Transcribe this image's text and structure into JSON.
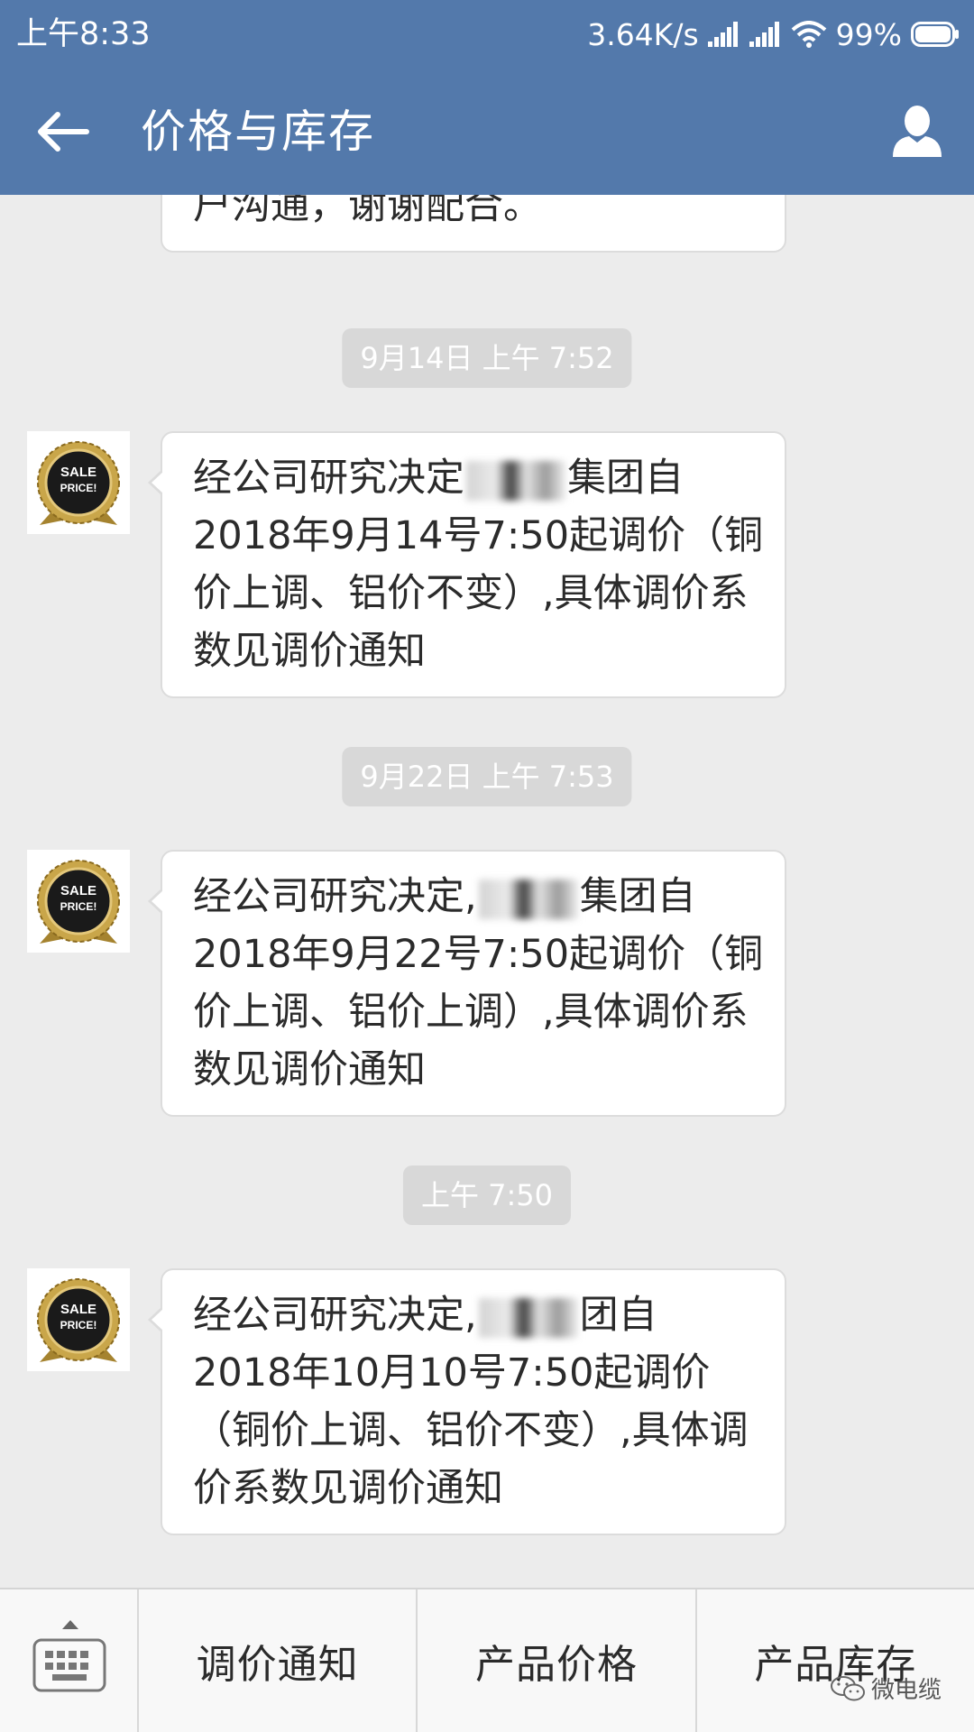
{
  "status_bar": {
    "time": "上午8:33",
    "network_speed": "3.64K/s",
    "battery": "99%",
    "icons": [
      "signal-icon",
      "signal-icon",
      "wifi-icon",
      "battery-icon"
    ]
  },
  "header": {
    "back_icon": "back-arrow-icon",
    "title": "价格与库存",
    "profile_icon": "person-icon"
  },
  "messages": [
    {
      "lines": [
        "户沟通，谢谢配合。"
      ]
    },
    {
      "timestamp": "9月14日  上午 7:52",
      "avatar": "SALE PRICE!",
      "lines": [
        {
          "before": "经公司研究决定",
          "after": "集团自"
        },
        "2018年9月14号7:50起调价（铜",
        "价上调、铝价不变）,具体调价系",
        "数见调价通知"
      ]
    },
    {
      "timestamp": "9月22日  上午 7:53",
      "avatar": "SALE PRICE!",
      "lines": [
        {
          "before": "经公司研究决定,",
          "after": "集团自"
        },
        "2018年9月22号7:50起调价（铜",
        "价上调、铝价上调）,具体调价系",
        "数见调价通知"
      ]
    },
    {
      "timestamp": "上午 7:50",
      "avatar": "SALE PRICE!",
      "lines": [
        {
          "before": "经公司研究决定,",
          "after": "团自"
        },
        "2018年10月10号7:50起调价",
        "（铜价上调、铝价不变）,具体调",
        "价系数见调价通知"
      ]
    }
  ],
  "bottom_menu": {
    "keyboard_icon": "keyboard-icon",
    "tabs": [
      "调价通知",
      "产品价格",
      "产品库存"
    ]
  },
  "watermark": {
    "text": "微电缆",
    "icon": "wechat-icon"
  },
  "colors": {
    "header_bg": "#5379ab",
    "chat_bg": "#ececec",
    "bubble_bg": "#ffffff",
    "timestamp_bg": "#d8d8d8"
  }
}
